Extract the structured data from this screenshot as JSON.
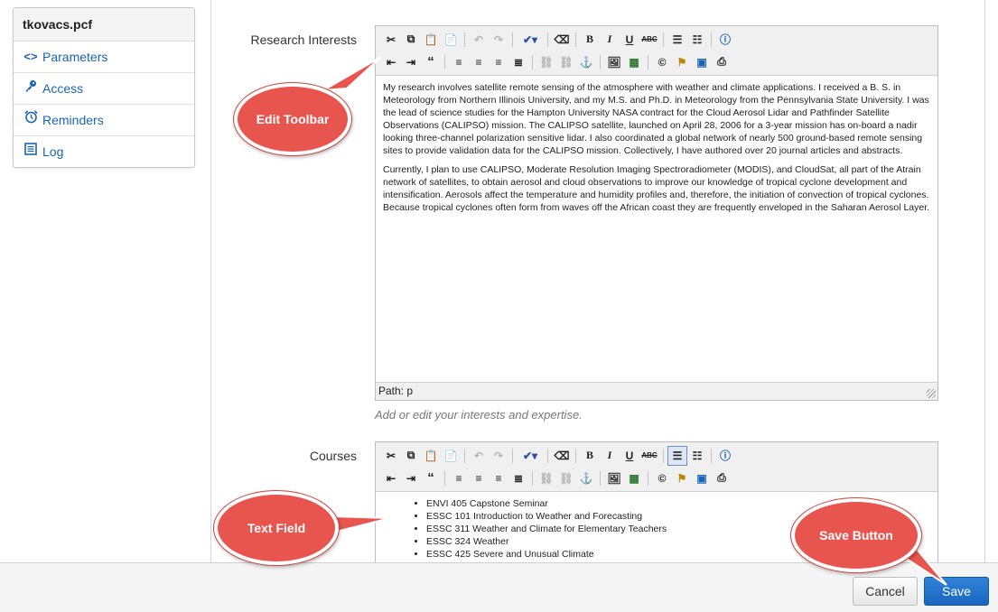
{
  "sidebar": {
    "title": "tkovacs.pcf",
    "items": [
      {
        "label": "Parameters",
        "icon": "code-icon"
      },
      {
        "label": "Access",
        "icon": "key-icon"
      },
      {
        "label": "Reminders",
        "icon": "alarm-clock-icon"
      },
      {
        "label": "Log",
        "icon": "log-list-icon"
      }
    ]
  },
  "research": {
    "label": "Research Interests",
    "paragraphs": [
      "My research involves satellite remote sensing of the atmosphere with weather and climate applications. I received a B. S. in Meteorology from Northern Illinois University, and my M.S. and Ph.D. in Meteorology from the Pennsylvania State University. I was the lead of science studies for the Hampton University NASA contract for the Cloud Aerosol Lidar and Pathfinder Satellite Observations (CALIPSO) mission. The CALIPSO satellite, launched on April 28, 2006 for a 3-year mission has on-board a nadir looking three-channel polarization sensitive lidar. I also coordinated a global network of nearly 500 ground-based remote sensing sites to provide validation data for the CALIPSO mission. Collectively, I have authored over 20 journal articles and abstracts.",
      "Currently, I plan to use CALIPSO, Moderate Resolution Imaging Spectroradiometer (MODIS), and CloudSat, all part of the Atrain network of satellites, to obtain aerosol and cloud observations to improve our knowledge of tropical cyclone development and intensification. Aerosols affect the temperature and humidity profiles and, therefore, the initiation of convection of tropical cyclones. Because tropical cyclones often form from waves off the African coast they are frequently enveloped in the Saharan Aerosol Layer."
    ],
    "path": "Path: p",
    "hint": "Add or edit your interests and expertise."
  },
  "courses": {
    "label": "Courses",
    "items": [
      "ENVI 405 Capstone Seminar",
      "ESSC 101 Introduction to Weather and Forecasting",
      "ESSC 311 Weather and Climate for Elementary Teachers",
      "ESSC 324 Weather",
      "ESSC 425 Severe and Unusual Climate"
    ]
  },
  "toolbar": {
    "row1": [
      "cut-icon",
      "copy-icon",
      "paste-icon",
      "paste-word-icon",
      "|",
      "undo-icon",
      "redo-icon",
      "|",
      "spellcheck-icon",
      "|",
      "eraser-icon",
      "|",
      "bold-icon",
      "italic-icon",
      "underline-icon",
      "strikethrough-icon",
      "|",
      "bullet-list-icon",
      "numbered-list-icon",
      "|",
      "help-icon"
    ],
    "row2": [
      "outdent-icon",
      "indent-icon",
      "blockquote-icon",
      "|",
      "align-left-icon",
      "align-center-icon",
      "align-right-icon",
      "align-justify-icon",
      "|",
      "link-icon",
      "unlink-icon",
      "anchor-icon",
      "|",
      "image-icon",
      "media-icon",
      "|",
      "copyright-icon",
      "cleanup-icon",
      "html-source-icon",
      "template-icon"
    ]
  },
  "annotations": {
    "edit_toolbar": "Edit Toolbar",
    "text_field": "Text Field",
    "save_button": "Save Button"
  },
  "footer": {
    "cancel_label": "Cancel",
    "save_label": "Save"
  },
  "colors": {
    "callout": "#e8554e",
    "link": "#1a64b5",
    "save": "#1866c0"
  }
}
